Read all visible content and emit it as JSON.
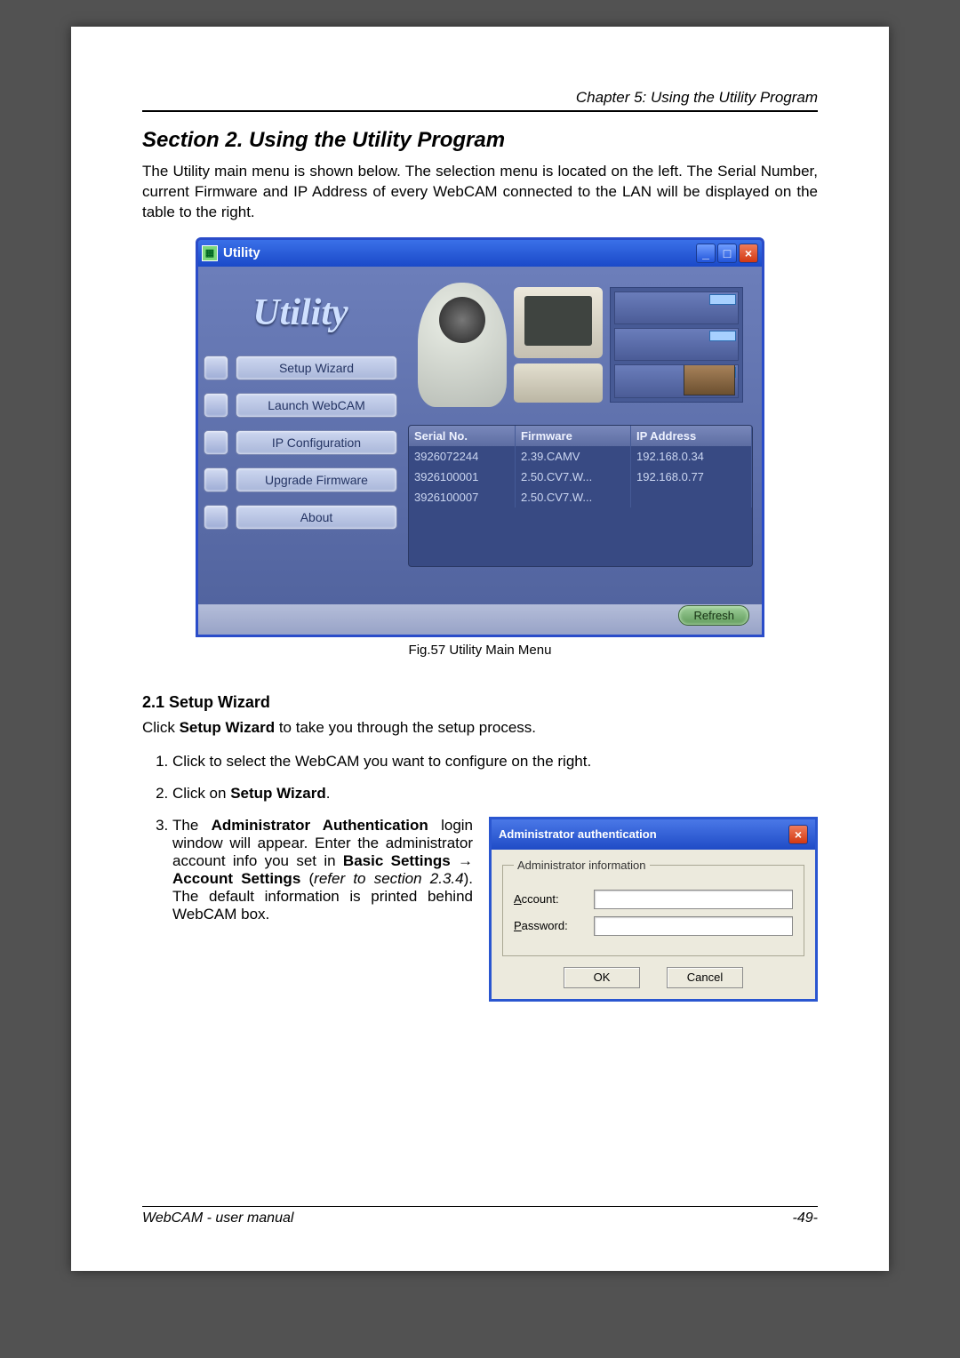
{
  "chapter_header": "Chapter 5: Using the Utility Program",
  "section_title": "Section 2. Using the Utility Program",
  "intro_text": "The Utility main menu is shown below.  The selection menu is located on the left. The Serial Number, current Firmware and IP Address of every WebCAM connected to the LAN will be displayed on the table to the right.",
  "fig_caption": "Fig.57  Utility Main Menu",
  "subsection_title": "2.1 Setup Wizard",
  "sub_intro_pre": "Click ",
  "sub_intro_bold": "Setup Wizard",
  "sub_intro_post": " to take you through the setup process.",
  "step1": "Click to select the WebCAM you want to configure on the right.",
  "step2_pre": "Click on ",
  "step2_bold": "Setup Wizard",
  "step2_post": ".",
  "step3_a": "The ",
  "step3_b": "Administrator Authentication",
  "step3_c": " login window will appear.  Enter the administrator account info you set in ",
  "step3_d": "Basic Settings → Account Settings",
  "step3_e": " (",
  "step3_f": "refer to section 2.3.4",
  "step3_g": ").  The default information is printed behind WebCAM box.",
  "footer_left": "WebCAM - user manual",
  "footer_right": "-49-",
  "utility": {
    "logo": "Utility",
    "menu": {
      "setup": "Setup Wizard",
      "launch": "Launch WebCAM",
      "ipconf": "IP Configuration",
      "upgrade": "Upgrade Firmware",
      "about": "About"
    },
    "titlebar": "Utility",
    "columns": {
      "c1": "Serial No.",
      "c2": "Firmware",
      "c3": "IP Address"
    },
    "rows": [
      {
        "sn": "3926072244",
        "fw": "2.39.CAMV",
        "ip": "192.168.0.34"
      },
      {
        "sn": "3926100001",
        "fw": "2.50.CV7.W...",
        "ip": "192.168.0.77"
      },
      {
        "sn": "3926100007",
        "fw": "2.50.CV7.W...",
        "ip": ""
      }
    ],
    "refresh": "Refresh"
  },
  "auth": {
    "title": "Administrator authentication",
    "legend": "Administrator information",
    "account_label_u": "A",
    "account_label_rest": "ccount:",
    "password_label_u": "P",
    "password_label_rest": "assword:",
    "ok": "OK",
    "cancel": "Cancel"
  }
}
